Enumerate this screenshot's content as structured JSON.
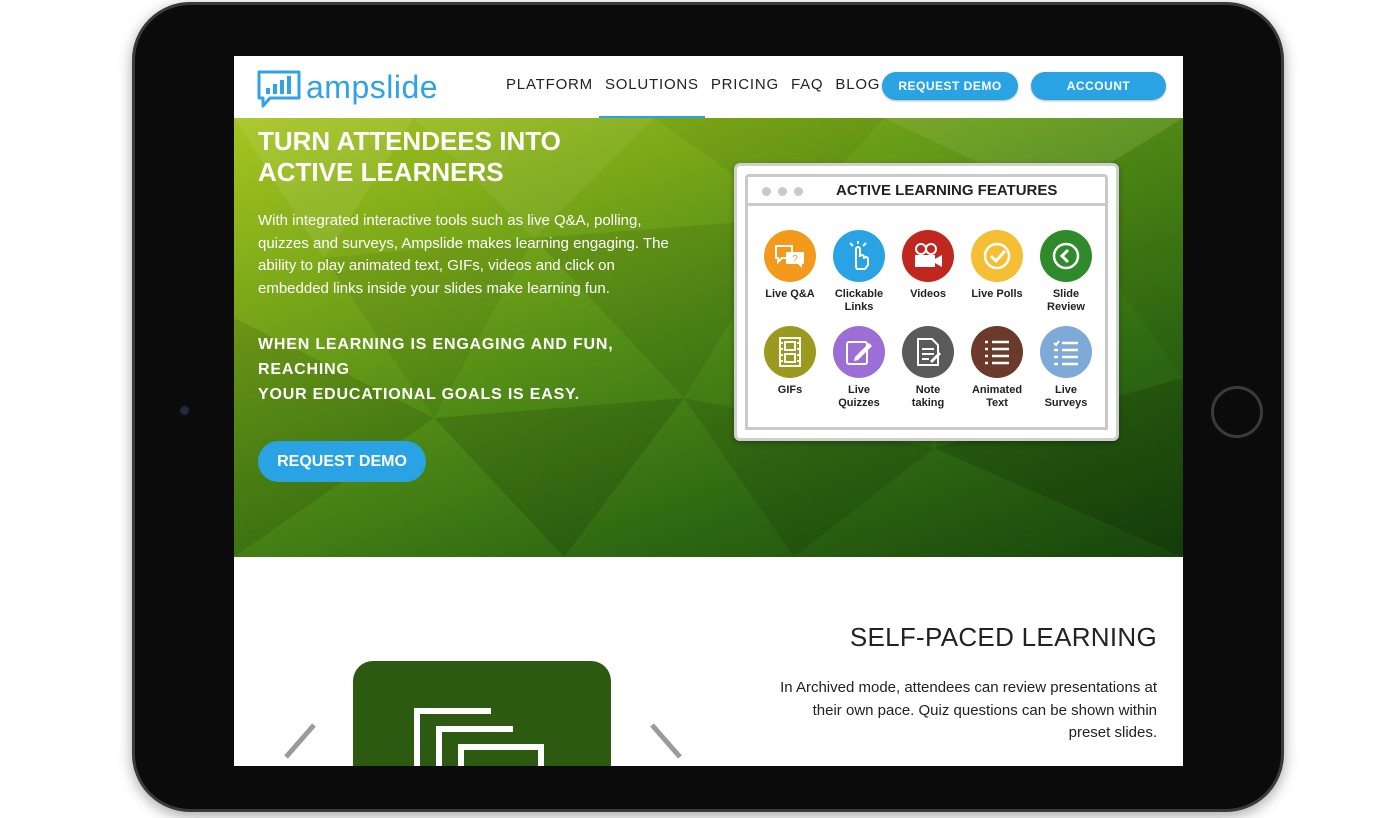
{
  "brand": {
    "name": "ampslide",
    "accent": "#2aa3e4"
  },
  "nav": {
    "items": [
      {
        "label": "PLATFORM"
      },
      {
        "label": "SOLUTIONS"
      },
      {
        "label": "PRICING"
      },
      {
        "label": "FAQ"
      },
      {
        "label": "BLOG"
      }
    ],
    "active": "SOLUTIONS",
    "request_demo": "REQUEST DEMO",
    "account": "ACCOUNT"
  },
  "hero": {
    "title_line1": "TURN ATTENDEES INTO",
    "title_line2": "ACTIVE LEARNERS",
    "paragraph": "With integrated interactive tools such as live Q&A, polling, quizzes and surveys, Ampslide makes learning engaging. The ability to play animated text, GIFs, videos and click on embedded links inside your slides make learning fun.",
    "tagline_line1": "WHEN LEARNING IS ENGAGING AND FUN,",
    "tagline_line2": "REACHING",
    "tagline_line3": "YOUR EDUCATIONAL GOALS IS EASY.",
    "cta": "REQUEST DEMO"
  },
  "features": {
    "title": "ACTIVE LEARNING FEATURES",
    "items": [
      {
        "line1": "Live Q&A",
        "line2": "",
        "icon": "chat-bubbles-icon",
        "color": "#f39a1d"
      },
      {
        "line1": "Clickable",
        "line2": "Links",
        "icon": "pointer-hand-icon",
        "color": "#2aa3e4"
      },
      {
        "line1": "Videos",
        "line2": "",
        "icon": "video-camera-icon",
        "color": "#c0271f"
      },
      {
        "line1": "Live Polls",
        "line2": "",
        "icon": "check-circle-icon",
        "color": "#f4bf34"
      },
      {
        "line1": "Slide",
        "line2": "Review",
        "icon": "back-arrow-icon",
        "color": "#2f8a2b"
      },
      {
        "line1": "GIFs",
        "line2": "",
        "icon": "film-strip-icon",
        "color": "#9a9a1f"
      },
      {
        "line1": "Live",
        "line2": "Quizzes",
        "icon": "pencil-edit-icon",
        "color": "#9d6fd6"
      },
      {
        "line1": "Note",
        "line2": "taking",
        "icon": "notepad-icon",
        "color": "#5a5a5a"
      },
      {
        "line1": "Animated",
        "line2": "Text",
        "icon": "text-lines-icon",
        "color": "#6b3a2a"
      },
      {
        "line1": "Live",
        "line2": "Surveys",
        "icon": "checklist-icon",
        "color": "#7fa9d6"
      }
    ]
  },
  "self_paced": {
    "title": "SELF-PACED LEARNING",
    "text": "In Archived mode, attendees can review presentations at their own pace. Quiz questions can be shown within preset slides."
  }
}
